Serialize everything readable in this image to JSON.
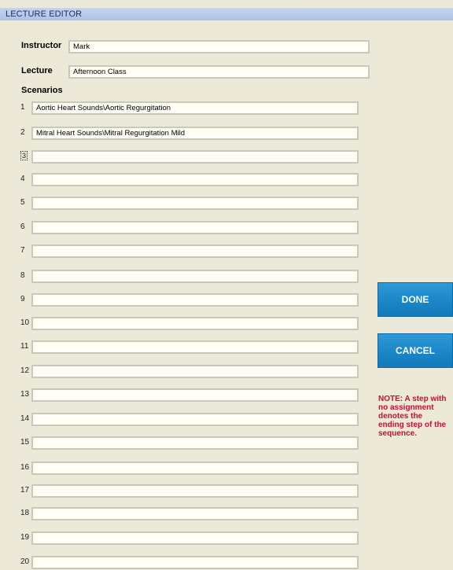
{
  "window": {
    "title": "LECTURE EDITOR"
  },
  "form": {
    "instructor_label": "Instructor",
    "instructor_value": "Mark",
    "lecture_label": "Lecture",
    "lecture_value": "Afternoon Class",
    "scenarios_label": "Scenarios"
  },
  "scenarios": [
    {
      "num": "1",
      "value": "Aortic Heart Sounds\\Aortic Regurgitation"
    },
    {
      "num": "2",
      "value": "Mitral Heart Sounds\\Mitral Regurgitation Mild"
    },
    {
      "num": "3",
      "value": ""
    },
    {
      "num": "4",
      "value": ""
    },
    {
      "num": "5",
      "value": ""
    },
    {
      "num": "6",
      "value": ""
    },
    {
      "num": "7",
      "value": ""
    },
    {
      "num": "8",
      "value": ""
    },
    {
      "num": "9",
      "value": ""
    },
    {
      "num": "10",
      "value": ""
    },
    {
      "num": "11",
      "value": ""
    },
    {
      "num": "12",
      "value": ""
    },
    {
      "num": "13",
      "value": ""
    },
    {
      "num": "14",
      "value": ""
    },
    {
      "num": "15",
      "value": ""
    },
    {
      "num": "16",
      "value": ""
    },
    {
      "num": "17",
      "value": ""
    },
    {
      "num": "18",
      "value": ""
    },
    {
      "num": "19",
      "value": ""
    },
    {
      "num": "20",
      "value": ""
    }
  ],
  "buttons": {
    "done_label": "DONE",
    "cancel_label": "CANCEL"
  },
  "note": {
    "text": "NOTE: A step with no assignment denotes the ending step of the sequence."
  },
  "colors": {
    "background": "#ece9d8",
    "button": "#1a86c8",
    "note": "#c8102e"
  }
}
